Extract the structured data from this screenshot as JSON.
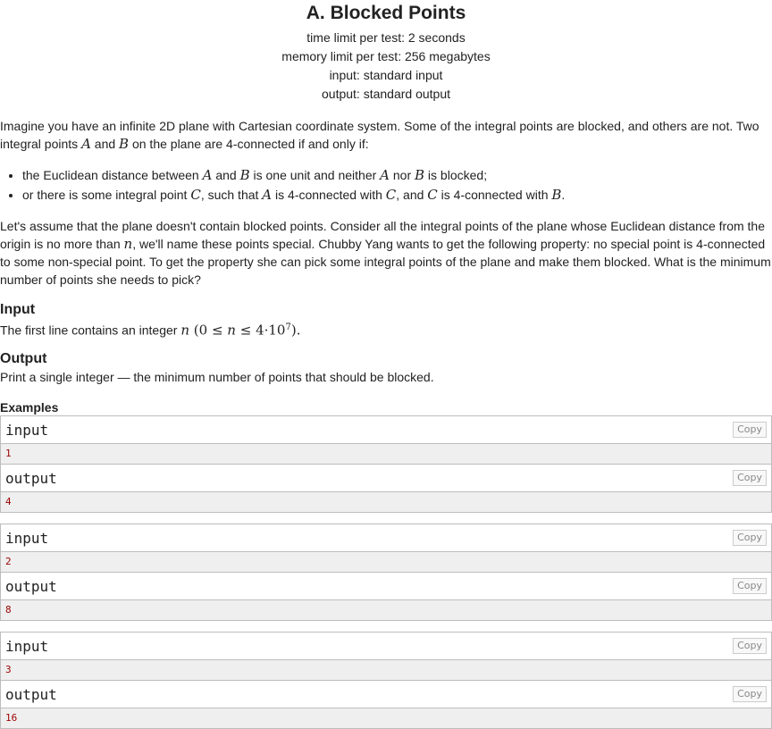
{
  "header": {
    "title": "A. Blocked Points",
    "time_limit": "time limit per test: 2 seconds",
    "memory_limit": "memory limit per test: 256 megabytes",
    "input": "input: standard input",
    "output": "output: standard output"
  },
  "statement": {
    "p1_a": "Imagine you have an infinite 2D plane with Cartesian coordinate system. Some of the integral points are blocked, and others are not. Two integral points ",
    "p1_A": "A",
    "p1_and": " and ",
    "p1_B": "B",
    "p1_b": " on the plane are 4-connected if and only if:",
    "b1_a": "the Euclidean distance between ",
    "b1_A": "A",
    "b1_and": " and ",
    "b1_B": "B",
    "b1_b": " is one unit and neither ",
    "b1_A2": "A",
    "b1_nor": " nor ",
    "b1_B2": "B",
    "b1_c": " is blocked;",
    "b2_a": "or there is some integral point ",
    "b2_C": "C",
    "b2_b": ", such that ",
    "b2_A": "A",
    "b2_c": " is 4-connected with ",
    "b2_C2": "C",
    "b2_d": ", and ",
    "b2_C3": "C",
    "b2_e": " is 4-connected with ",
    "b2_B": "B",
    "b2_f": ".",
    "p2_a": "Let's assume that the plane doesn't contain blocked points. Consider all the integral points of the plane whose Euclidean distance from the origin is no more than ",
    "p2_n": "n",
    "p2_b": ", we'll name these points special. Chubby Yang wants to get the following property: no special point is 4-connected to some non-special point. To get the property she can pick some integral points of the plane and make them blocked. What is the minimum number of points she needs to pick?"
  },
  "input_section": {
    "title": "Input",
    "text_a": "The first line contains an integer ",
    "n": "n",
    "math_open": " (0 ≤ ",
    "math_n": "n",
    "math_mid": " ≤ 4·10",
    "math_exp": "7",
    "math_close": ")."
  },
  "output_section": {
    "title": "Output",
    "text": "Print a single integer — the minimum number of points that should be blocked."
  },
  "examples": {
    "title": "Examples",
    "input_label": "input",
    "output_label": "output",
    "copy_label": "Copy",
    "items": [
      {
        "input": "1",
        "output": "4"
      },
      {
        "input": "2",
        "output": "8"
      },
      {
        "input": "3",
        "output": "16"
      }
    ]
  }
}
